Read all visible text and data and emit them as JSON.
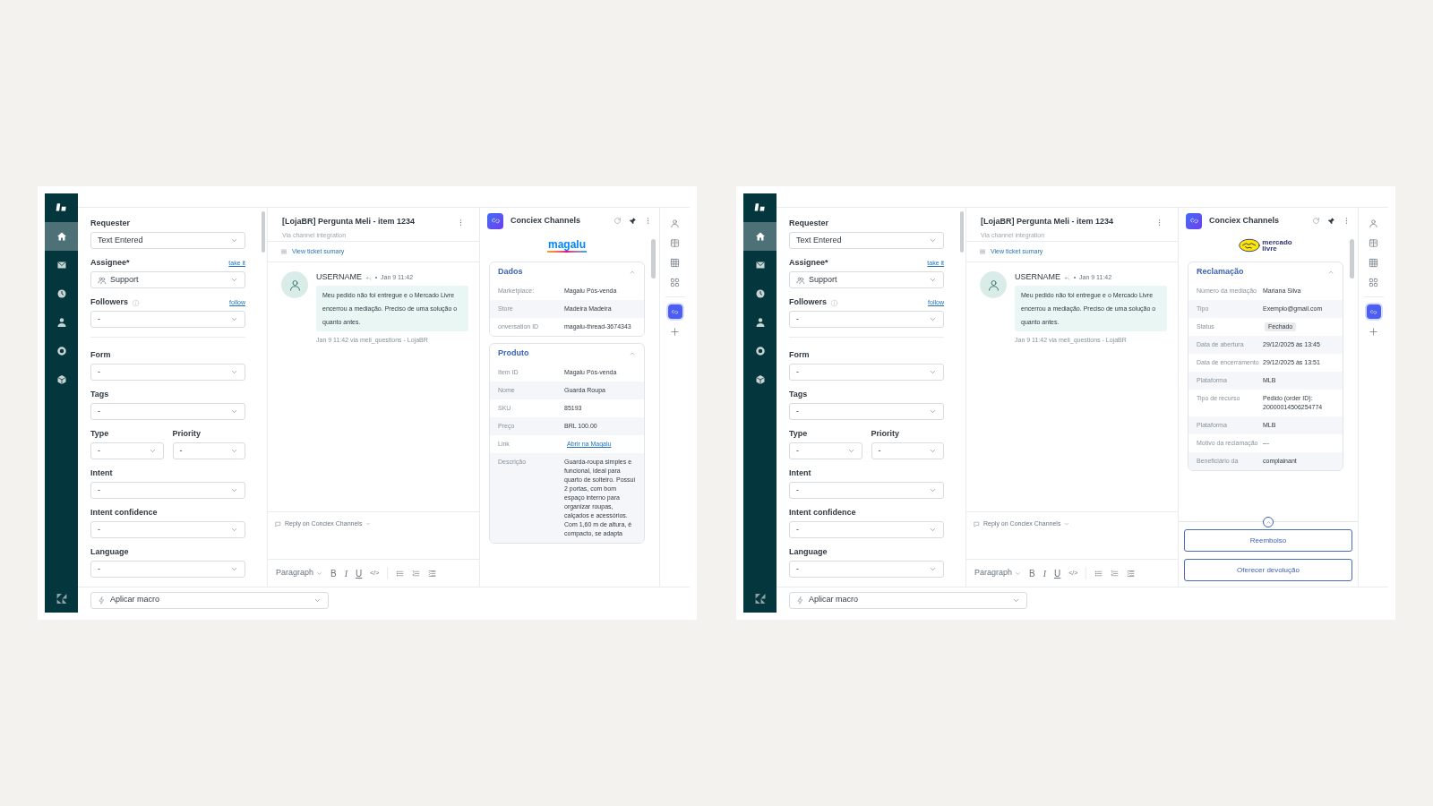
{
  "screens": [
    {
      "nav": [
        {
          "selected": true
        },
        {
          "selected": false
        },
        {
          "selected": false
        },
        {
          "selected": false
        },
        {
          "selected": false
        },
        {
          "selected": false
        }
      ],
      "form": [
        {
          "kind": "select",
          "label": "Requester",
          "value": "Text Entered",
          "help": false
        },
        {
          "kind": "group-select",
          "label": "Assignee*",
          "value": "Support",
          "link": "take it",
          "help": false
        },
        {
          "kind": "select",
          "label": "Followers",
          "value": "-",
          "link": "follow",
          "help": true
        },
        {
          "kind": "divider"
        },
        {
          "kind": "select",
          "label": "Form",
          "value": "-",
          "help": false
        },
        {
          "kind": "select",
          "label": "Tags",
          "value": "-",
          "help": false
        },
        {
          "kind": "half",
          "label": "Type",
          "value": "-",
          "help": false
        },
        {
          "kind": "half",
          "label": "Priority",
          "value": "-",
          "help": false
        },
        {
          "kind": "select",
          "label": "Intent",
          "value": "-",
          "help": false
        },
        {
          "kind": "select",
          "label": "Intent confidence",
          "value": "-",
          "help": false
        },
        {
          "kind": "select",
          "label": "Language",
          "value": "-",
          "help": false
        }
      ],
      "ticket": {
        "title": "[LojaBR] Pergunta Meli - item 1234",
        "subtitle": "Via channel integration",
        "summary_link": "View ticket sumary",
        "message": {
          "author": "USERNAME",
          "time": "Jan 9 11:42",
          "body": "Meu pedido não foi entregue e o Mercado Livre encerrou a mediação. Preciso de uma solução o quanto antes.",
          "meta": "Jan 9 11:42 via meli_questions - LojaBR"
        },
        "reply_channel": "Reply on Conciex Channels",
        "paragraph": "Paragraph",
        "format": [
          "B",
          "I",
          "U",
          "</>"
        ]
      },
      "macro": "Aplicar macro",
      "app": {
        "name": "Conciex Channels",
        "marketplace": {
          "kind": "magalu",
          "lines": [
            "magalu"
          ]
        },
        "sections": [
          {
            "title": "Dados",
            "expanded": true,
            "rows": [
              {
                "kind": "text",
                "label": "Marketplace:",
                "value": "Magalu Pós-venda"
              },
              {
                "kind": "text",
                "label": "Store",
                "value": "Madeira Madeira"
              },
              {
                "kind": "text",
                "label": "onversation ID",
                "value": "magalu-thread-3674343"
              }
            ]
          },
          {
            "title": "Produto",
            "expanded": true,
            "rows": [
              {
                "kind": "text",
                "label": "Item ID",
                "value": "Magalu Pós-venda"
              },
              {
                "kind": "text",
                "label": "Nome",
                "value": "Guarda Roupa"
              },
              {
                "kind": "text",
                "label": "SKU",
                "value": "85193"
              },
              {
                "kind": "text",
                "label": "Preço",
                "value": "BRL 100.00"
              },
              {
                "kind": "link",
                "label": "Link",
                "value": "Abrir na Magalu"
              },
              {
                "kind": "text",
                "label": "Descrição",
                "value": "Guarda-roupa simples e funcional, ideal para quarto de solteiro. Possui 2 portas, com bom espaço interno para organizar roupas, calçados e acessórios. Com 1,60 m de altura, é compacto, se adapta"
              }
            ]
          }
        ]
      },
      "rail": [
        {
          "selected": false
        },
        {
          "selected": false
        },
        {
          "selected": false
        },
        {
          "selected": false
        },
        {
          "selected": true
        },
        {
          "selected": false
        }
      ]
    },
    {
      "nav": [
        {
          "selected": true
        },
        {
          "selected": false
        },
        {
          "selected": false
        },
        {
          "selected": false
        },
        {
          "selected": false
        },
        {
          "selected": false
        }
      ],
      "form": [
        {
          "kind": "select",
          "label": "Requester",
          "value": "Text Entered",
          "help": false
        },
        {
          "kind": "group-select",
          "label": "Assignee*",
          "value": "Support",
          "link": "take it",
          "help": false
        },
        {
          "kind": "select",
          "label": "Followers",
          "value": "-",
          "link": "follow",
          "help": true
        },
        {
          "kind": "divider"
        },
        {
          "kind": "select",
          "label": "Form",
          "value": "-",
          "help": false
        },
        {
          "kind": "select",
          "label": "Tags",
          "value": "-",
          "help": false
        },
        {
          "kind": "half",
          "label": "Type",
          "value": "-",
          "help": false
        },
        {
          "kind": "half",
          "label": "Priority",
          "value": "-",
          "help": false
        },
        {
          "kind": "select",
          "label": "Intent",
          "value": "-",
          "help": false
        },
        {
          "kind": "select",
          "label": "Intent confidence",
          "value": "-",
          "help": false
        },
        {
          "kind": "select",
          "label": "Language",
          "value": "-",
          "help": false
        }
      ],
      "ticket": {
        "title": "[LojaBR] Pergunta Meli - item 1234",
        "subtitle": "Via channel integration",
        "summary_link": "View ticket sumary",
        "message": {
          "author": "USERNAME",
          "time": "Jan 9 11:42",
          "body": "Meu pedido não foi entregue e o Mercado Livre encerrou a mediação. Preciso de uma solução o quanto antes.",
          "meta": "Jan 9 11:42 via meli_questions - LojaBR"
        },
        "reply_channel": "Reply on Conciex Channels",
        "paragraph": "Paragraph",
        "format": [
          "B",
          "I",
          "U",
          "</>"
        ]
      },
      "macro": "Aplicar macro",
      "app": {
        "name": "Conciex Channels",
        "marketplace": {
          "kind": "mercadolivre",
          "lines": [
            "mercado",
            "livre"
          ]
        },
        "sections": [
          {
            "title": "Reclamação",
            "expanded": true,
            "rows": [
              {
                "kind": "text",
                "label": "Número da mediação",
                "value": "Mariana Silva"
              },
              {
                "kind": "text",
                "label": "Tipo",
                "value": "Exemplo@gmail.com"
              },
              {
                "kind": "badge",
                "label": "Status",
                "value": "Fechado"
              },
              {
                "kind": "text",
                "label": "Data de abertura",
                "value": "29/12/2025 às 13:45"
              },
              {
                "kind": "text",
                "label": "Data de encerramento",
                "value": "29/12/2025 às 13:51"
              },
              {
                "kind": "text",
                "label": "Plataforma",
                "value": "MLB"
              },
              {
                "kind": "text",
                "label": "Tipo de recurso",
                "value": "Pedido (order ID): 20000014506254774"
              },
              {
                "kind": "text",
                "label": "Plataforma",
                "value": "MLB"
              },
              {
                "kind": "text",
                "label": "Motivo da reclamação",
                "value": "---"
              },
              {
                "kind": "text",
                "label": "Beneficiário da",
                "value": "complainant"
              }
            ]
          }
        ],
        "actions": [
          "Reembolso",
          "Oferecer devolução"
        ]
      },
      "rail": [
        {
          "selected": false
        },
        {
          "selected": false
        },
        {
          "selected": false
        },
        {
          "selected": false
        },
        {
          "selected": true
        },
        {
          "selected": false
        }
      ]
    }
  ]
}
